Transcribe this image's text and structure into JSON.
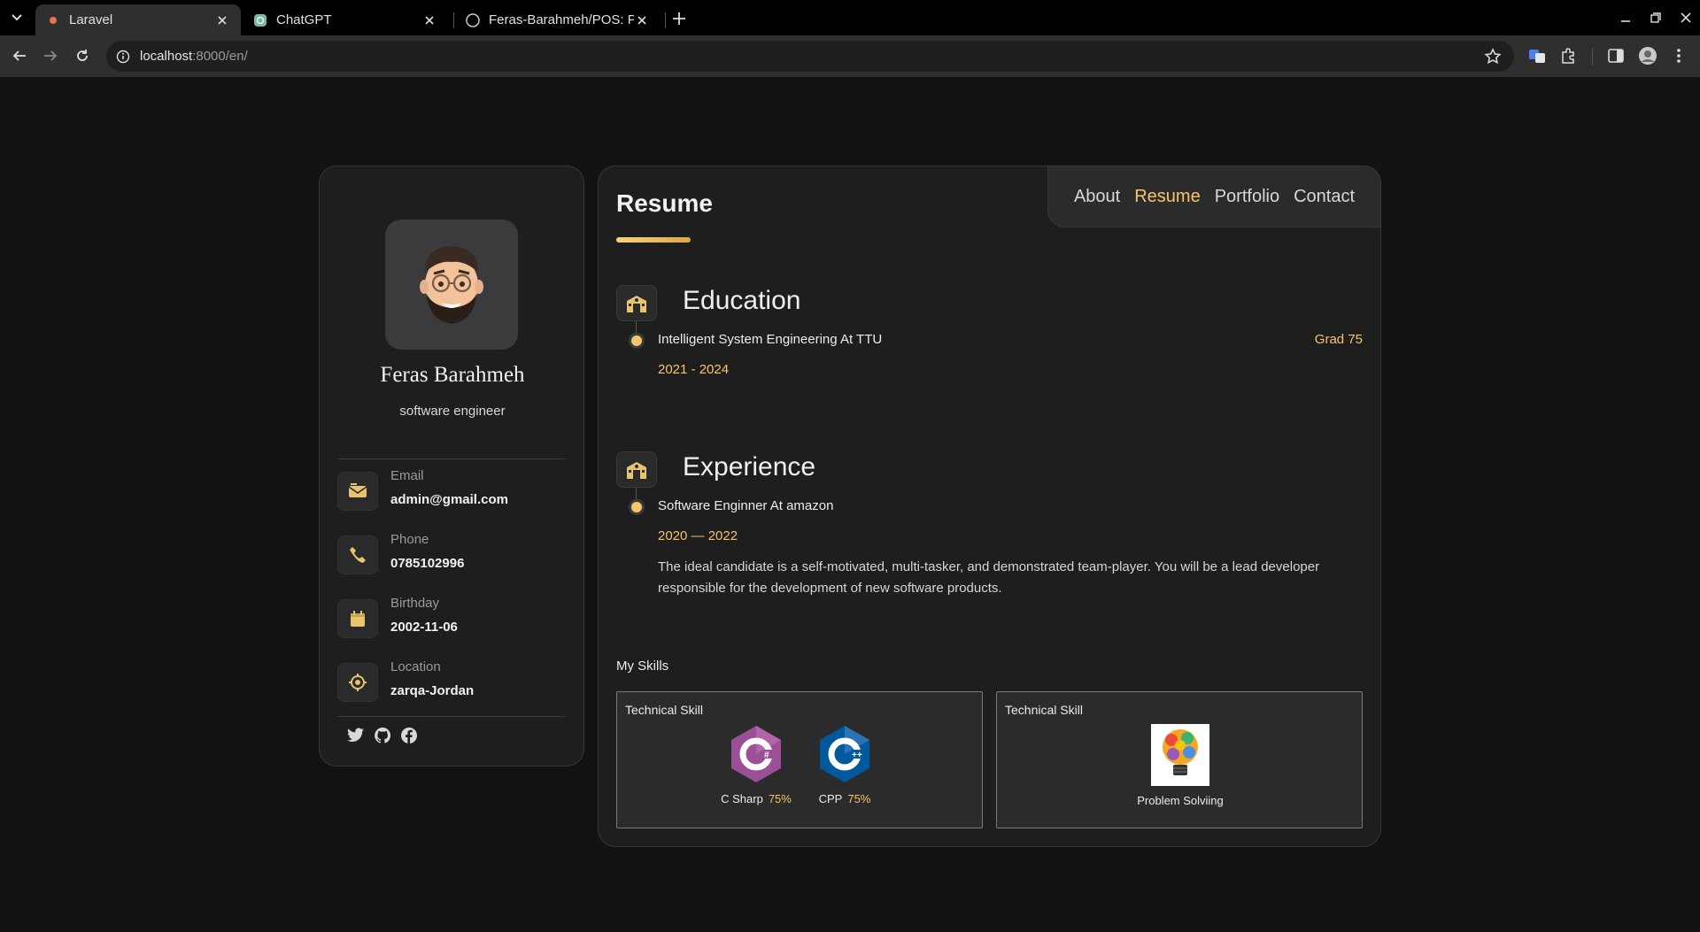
{
  "browser": {
    "tabs": [
      {
        "title": "Laravel",
        "active": true
      },
      {
        "title": "ChatGPT",
        "active": false
      },
      {
        "title": "Feras-Barahmeh/POS: P",
        "active": false
      }
    ],
    "url_host": "localhost",
    "url_rest": ":8000/en/"
  },
  "profile": {
    "name": "Feras Barahmeh",
    "role": "software engineer",
    "contacts": [
      {
        "label": "Email",
        "value": "admin@gmail.com",
        "icon": "mail-icon"
      },
      {
        "label": "Phone",
        "value": "0785102996",
        "icon": "phone-icon"
      },
      {
        "label": "Birthday",
        "value": "2002-11-06",
        "icon": "calendar-icon"
      },
      {
        "label": "Location",
        "value": "zarqa-Jordan",
        "icon": "location-icon"
      }
    ],
    "socials": [
      "twitter-icon",
      "github-icon",
      "facebook-icon"
    ]
  },
  "nav": {
    "items": [
      "About",
      "Resume",
      "Portfolio",
      "Contact"
    ],
    "active": "Resume"
  },
  "resume": {
    "title": "Resume",
    "education": {
      "title": "Education",
      "items": [
        {
          "title": "Intelligent System Engineering At TTU",
          "date": "2021 - 2024",
          "grade": "Grad 75"
        }
      ]
    },
    "experience": {
      "title": "Experience",
      "items": [
        {
          "title": "Software Enginner At amazon",
          "date": "2020 — 2022",
          "description": "The ideal candidate is a self-motivated, multi-tasker, and demonstrated team-player. You will be a lead developer responsible for the development of new software products."
        }
      ]
    },
    "skills": {
      "title": "My Skills",
      "cards": [
        {
          "header": "Technical Skill",
          "skills": [
            {
              "name": "C Sharp",
              "percent": "75%"
            },
            {
              "name": "CPP",
              "percent": "75%"
            }
          ]
        },
        {
          "header": "Technical Skill",
          "skills": [
            {
              "name": "Problem Solviing",
              "percent": ""
            }
          ]
        }
      ]
    }
  },
  "colors": {
    "accent": "#f7c46a",
    "background": "#121212",
    "card": "#1e1e1f"
  }
}
